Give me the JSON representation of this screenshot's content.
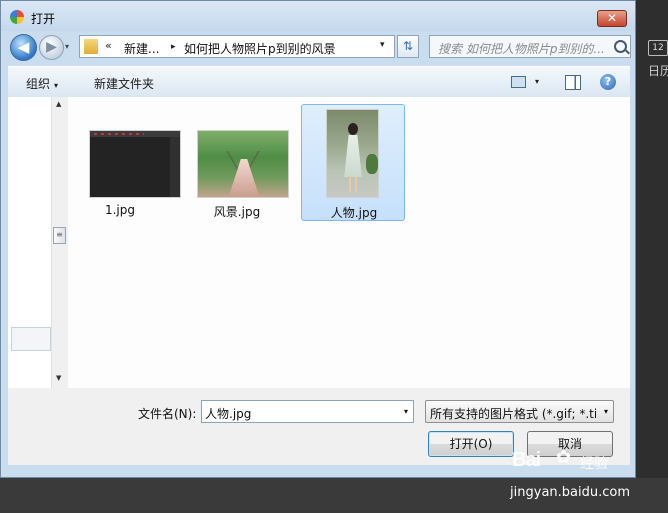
{
  "dialog": {
    "title": "打开",
    "close_label": "✕"
  },
  "nav": {
    "back_glyph": "◀",
    "forward_glyph": "▶",
    "history_glyph": "▾",
    "address": {
      "chevron": "«",
      "crumbs": [
        "新建...",
        "如何把人物照片p到别的风景"
      ],
      "separator": "▸",
      "dropdown_glyph": "▾"
    },
    "refresh_glyph": "⇅",
    "search_placeholder": "搜索 如何把人物照片p到别的..."
  },
  "toolbar": {
    "organize_label": "组织",
    "organize_caret": "▾",
    "new_folder_label": "新建文件夹",
    "view_caret": "▾",
    "help_label": "?"
  },
  "scrollbar": {
    "up_glyph": "▲",
    "down_glyph": "▼",
    "thumb_glyph": "≡"
  },
  "files": [
    {
      "name": "1.jpg",
      "thumbnail": "dark-screenshot",
      "selected": false
    },
    {
      "name": "风景.jpg",
      "thumbnail": "bridge-landscape",
      "selected": false
    },
    {
      "name": "人物.jpg",
      "thumbnail": "person-portrait",
      "selected": true
    }
  ],
  "footer": {
    "filename_label": "文件名(N):",
    "filename_value": "人物.jpg",
    "filename_drop_glyph": "▾",
    "filetype_value": "所有支持的图片格式 (*.gif; *.tif",
    "filetype_drop_glyph": "▾",
    "open_label": "打开(O)",
    "cancel_label": "取消"
  },
  "background_app": {
    "icon_label": "12",
    "text": "日历"
  },
  "watermark": {
    "logo_text": "Bai",
    "logo_text_2": "经验",
    "url": "jingyan.baidu.com"
  },
  "colors": {
    "accent": "#3b7dd8",
    "selection": "#c6e0fb",
    "titlebar": "#c9ddef"
  }
}
